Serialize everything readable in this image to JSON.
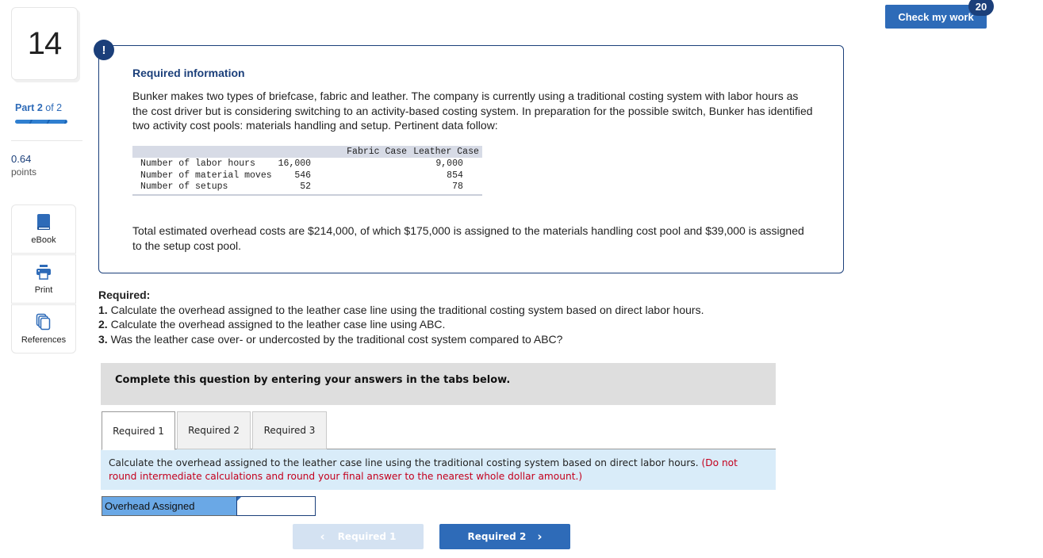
{
  "question": {
    "number": "14",
    "part_prefix": "Part",
    "part_current": "2",
    "part_of": "of 2",
    "points_value": "0.64",
    "points_label": "points"
  },
  "tools": [
    {
      "label": "eBook",
      "icon": "book-icon"
    },
    {
      "label": "Print",
      "icon": "printer-icon"
    },
    {
      "label": "References",
      "icon": "references-icon"
    }
  ],
  "header": {
    "check_label": "Check my work",
    "check_badge": "20"
  },
  "info": {
    "alert_glyph": "!",
    "title": "Required information",
    "paragraph1": "Bunker makes two types of briefcase, fabric and leather. The company is currently using a traditional costing system with labor hours as the cost driver but is considering switching to an activity-based costing system. In preparation for the possible switch, Bunker has identified two activity cost pools: materials handling and setup. Pertinent data follow:",
    "table": {
      "headers": [
        "",
        "Fabric Case",
        "Leather Case"
      ],
      "rows": [
        [
          "Number of labor hours",
          "16,000",
          "9,000"
        ],
        [
          "Number of material moves",
          "546",
          "854"
        ],
        [
          "Number of setups",
          "52",
          "78"
        ]
      ]
    },
    "paragraph2": "Total estimated overhead costs are $214,000, of which $175,000 is assigned to the materials handling cost pool and $39,000 is assigned to the setup cost pool."
  },
  "required": {
    "heading": "Required:",
    "items": [
      {
        "num": "1.",
        "text": " Calculate the overhead assigned to the leather case line using the traditional costing system based on direct labor hours."
      },
      {
        "num": "2.",
        "text": " Calculate the overhead assigned to the leather case line using ABC."
      },
      {
        "num": "3.",
        "text": " Was the leather case over- or undercosted by the traditional cost system compared to ABC?"
      }
    ]
  },
  "panel": {
    "instruction": "Complete this question by entering your answers in the tabs below.",
    "tabs": [
      "Required 1",
      "Required 2",
      "Required 3"
    ],
    "active_tab": "Required 1",
    "prompt_text": "Calculate the overhead assigned to the leather case line using the traditional costing system based on direct labor hours. ",
    "prompt_note": "(Do not round intermediate calculations and round your final answer to the nearest whole dollar amount.)",
    "answer_label": "Overhead Assigned",
    "answer_value": "",
    "prev_label": "Required 1",
    "next_label": "Required 2",
    "prev_glyph": "‹",
    "next_glyph": "›"
  },
  "colors": {
    "brand_navy": "#1b3f7a",
    "brand_blue": "#2e6bb8",
    "prompt_bg": "#d9ecf9",
    "warning_red": "#c4001d",
    "answer_label_bg": "#6aa8e6"
  }
}
